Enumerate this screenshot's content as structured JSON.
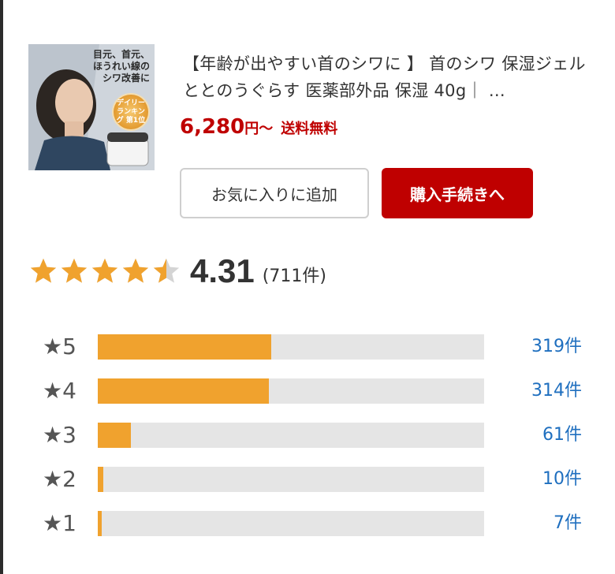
{
  "product": {
    "image_caption": [
      "目元、首元、",
      "ほうれい線の",
      "シワ改善に"
    ],
    "image_badge": "デイリー ランキング 第1位",
    "title": "【年齢が出やすい首のシワに 】 首のシワ 保湿ジェル ととのうぐらす 医薬部外品 保湿 40g｜ …",
    "price_amount": "6,280",
    "price_unit": "円〜",
    "shipping": "送料無料"
  },
  "buttons": {
    "favorite_label": "お気に入りに追加",
    "buy_label": "購入手続きへ"
  },
  "rating": {
    "score": "4.31",
    "score_value": 4.31,
    "review_count": "(711件)",
    "star_color": "#f0a22e",
    "star_empty_color": "#d4d4d4"
  },
  "distribution": [
    {
      "label": "★5",
      "count": "319件",
      "fraction": 0.449
    },
    {
      "label": "★4",
      "count": "314件",
      "fraction": 0.442
    },
    {
      "label": "★3",
      "count": "61件",
      "fraction": 0.086
    },
    {
      "label": "★2",
      "count": "10件",
      "fraction": 0.014
    },
    {
      "label": "★1",
      "count": "7件",
      "fraction": 0.01
    }
  ],
  "colors": {
    "accent_red": "#bf0000",
    "bar_fill": "#f0a22e",
    "bar_track": "#e5e5e5",
    "link_blue": "#1f6fbf"
  }
}
